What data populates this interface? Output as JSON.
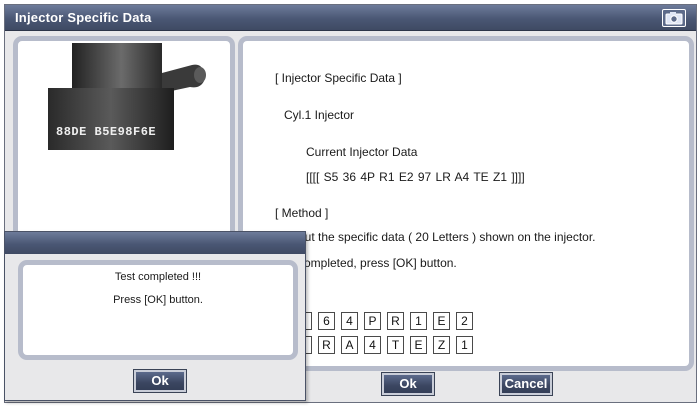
{
  "window": {
    "title": "Injector Specific Data",
    "icon": "camera-icon"
  },
  "content": {
    "heading": "[ Injector Specific Data ]",
    "cylinder": "Cyl.1 Injector",
    "current_label": "Current Injector Data",
    "current_value": "[[[[  S5  36  4P  R1  E2  97  LR  A4  TE  Z1  ]]]]",
    "method_heading": "[ Method ]",
    "method_line1": "but the specific data ( 20 Letters ) shown on the injector.",
    "method_line2": "completed, press [OK] button.",
    "row1": [
      "6",
      "4",
      "P",
      "R",
      "1",
      "E",
      "2"
    ],
    "row2": [
      "R",
      "A",
      "4",
      "T",
      "E",
      "Z",
      "1"
    ]
  },
  "injector_label": "88DE B5E98F6E",
  "buttons": {
    "ok": "Ok",
    "cancel": "Cancel"
  },
  "dialog": {
    "line1": "Test completed !!!",
    "line2": "Press [OK] button.",
    "ok": "Ok"
  }
}
